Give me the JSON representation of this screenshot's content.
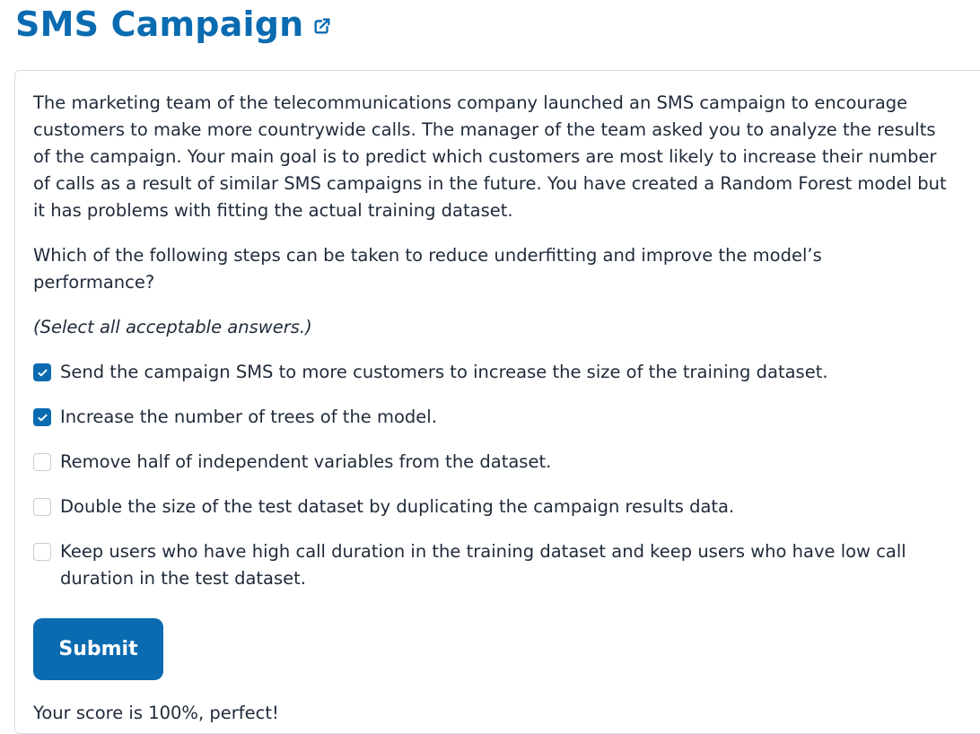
{
  "header": {
    "title": "SMS Campaign",
    "external_link_icon": "external-link-icon"
  },
  "question": {
    "paragraph1": "The marketing team of the telecommunications company launched an SMS campaign to encourage customers to make more countrywide calls. The manager of the team asked you to analyze the results of the campaign.  Your main goal is to predict which customers are most likely to increase their number of calls as a result of similar SMS campaigns in the future. You have created a Random Forest model but it has problems with fitting the actual training dataset.",
    "paragraph2": "Which of the following steps can be taken to reduce underfitting and improve the model’s performance?",
    "hint": "(Select all acceptable answers.)"
  },
  "options": [
    {
      "label": "Send the campaign SMS to more customers to increase the size of the training dataset.",
      "checked": true
    },
    {
      "label": "Increase the number of trees of the model.",
      "checked": true
    },
    {
      "label": "Remove half of independent variables from the dataset.",
      "checked": false
    },
    {
      "label": "Double the size of the test dataset by duplicating the campaign results data.",
      "checked": false
    },
    {
      "label": "Keep users who have high call duration in the training dataset and keep users who have low call duration in the test dataset.",
      "checked": false
    }
  ],
  "submit_label": "Submit",
  "score_text": "Your score is 100%, perfect!",
  "colors": {
    "accent": "#0b6bb1",
    "text": "#1f2a3a",
    "border": "#d7dde4"
  }
}
